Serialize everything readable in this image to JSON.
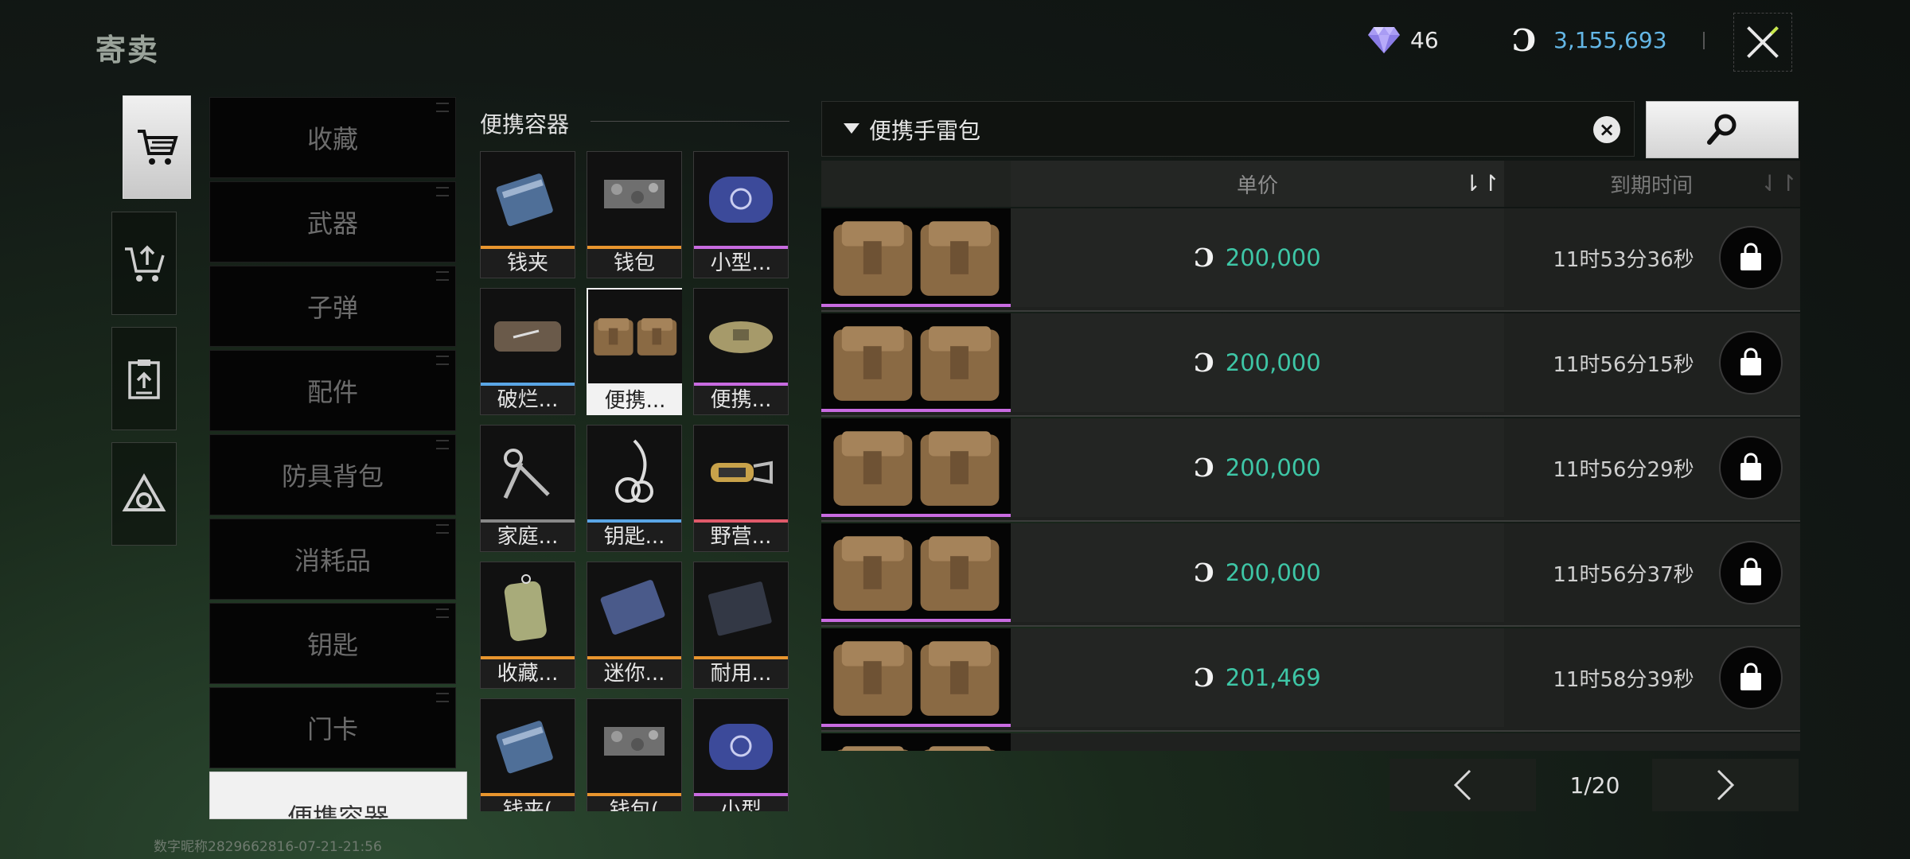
{
  "header": {
    "title": "寄卖",
    "gem_count": "46",
    "balance": "3,155,693"
  },
  "rail": [
    {
      "name": "buy",
      "icon": "cart-icon",
      "active": true
    },
    {
      "name": "sell",
      "icon": "cart-upload-icon",
      "active": false
    },
    {
      "name": "records",
      "icon": "clipboard-upload-icon",
      "active": false
    },
    {
      "name": "special",
      "icon": "triangle-emblem-icon",
      "active": false
    }
  ],
  "categories": [
    "收藏",
    "武器",
    "子弹",
    "配件",
    "防具背包",
    "消耗品",
    "钥匙",
    "门卡",
    "便携容器"
  ],
  "selected_category": "便携容器",
  "grid": {
    "title": "便携容器",
    "items": [
      {
        "label": "钱夹",
        "rarity": "#e8952e",
        "icon": "wallet-blue-icon"
      },
      {
        "label": "钱包",
        "rarity": "#e8952e",
        "icon": "wallet-camo-icon"
      },
      {
        "label": "小型...",
        "rarity": "#c86be0",
        "icon": "pouch-blue-icon"
      },
      {
        "label": "破烂...",
        "rarity": "#5aa6e6",
        "icon": "pouch-ragged-icon"
      },
      {
        "label": "便携...",
        "rarity": "#f0f0f0",
        "icon": "grenade-pouch-icon",
        "selected": true
      },
      {
        "label": "便携...",
        "rarity": "#c86be0",
        "icon": "waist-pack-icon"
      },
      {
        "label": "家庭...",
        "rarity": "#888888",
        "icon": "keys-icon"
      },
      {
        "label": "钥匙...",
        "rarity": "#5aa6e6",
        "icon": "keyring-icon"
      },
      {
        "label": "野营...",
        "rarity": "#e05a6a",
        "icon": "carabiner-icon"
      },
      {
        "label": "收藏...",
        "rarity": "#e8952e",
        "icon": "pouch-green-icon"
      },
      {
        "label": "迷你...",
        "rarity": "#e8952e",
        "icon": "case-blue-icon"
      },
      {
        "label": "耐用...",
        "rarity": "#e8952e",
        "icon": "case-dark-icon"
      },
      {
        "label": "钱夹(",
        "rarity": "#e8952e",
        "icon": "wallet-blue-icon"
      },
      {
        "label": "钱包(",
        "rarity": "#e8952e",
        "icon": "wallet-camo-icon"
      },
      {
        "label": "小型",
        "rarity": "#c86be0",
        "icon": "pouch-blue-icon"
      }
    ]
  },
  "search": {
    "value": "便携手雷包"
  },
  "table": {
    "col_price": "单价",
    "col_expire": "到期时间",
    "rows": [
      {
        "price": "200,000",
        "time": "11时53分36秒"
      },
      {
        "price": "200,000",
        "time": "11时56分15秒"
      },
      {
        "price": "200,000",
        "time": "11时56分29秒"
      },
      {
        "price": "200,000",
        "time": "11时56分37秒"
      },
      {
        "price": "201,469",
        "time": "11时58分39秒"
      },
      {
        "price": "",
        "time": ""
      }
    ]
  },
  "pagination": {
    "text": "1/20"
  },
  "watermark": "数字昵称2829662816-07-21-21:56",
  "colors": {
    "price": "#3ec6a6",
    "balance": "#64b7e6",
    "rarity_orange": "#e8952e",
    "rarity_purple": "#c86be0",
    "rarity_blue": "#5aa6e6",
    "rarity_red": "#e05a6a"
  }
}
